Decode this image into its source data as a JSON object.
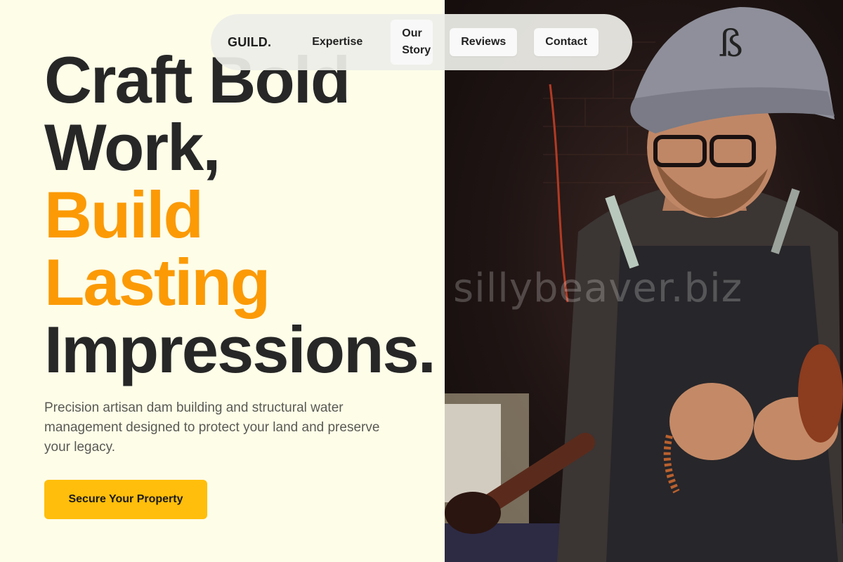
{
  "nav": {
    "logo": "GUILD.",
    "items": [
      {
        "label": "Expertise"
      },
      {
        "label": "Our Story"
      },
      {
        "label": "Reviews"
      },
      {
        "label": "Contact"
      }
    ]
  },
  "hero": {
    "line1": "Craft Bold",
    "line2": "Work,",
    "line3": "Build",
    "line4": "Lasting",
    "line5": "Impressions.",
    "subtitle": "Precision artisan dam building and structural water management designed to protect your land and preserve your legacy.",
    "cta_label": "Secure Your Property"
  },
  "image": {
    "watermark": "sillybeaver.biz"
  },
  "colors": {
    "background": "#fefde8",
    "accent": "#fb9a05",
    "cta": "#ffbe0b",
    "text": "#272727"
  }
}
